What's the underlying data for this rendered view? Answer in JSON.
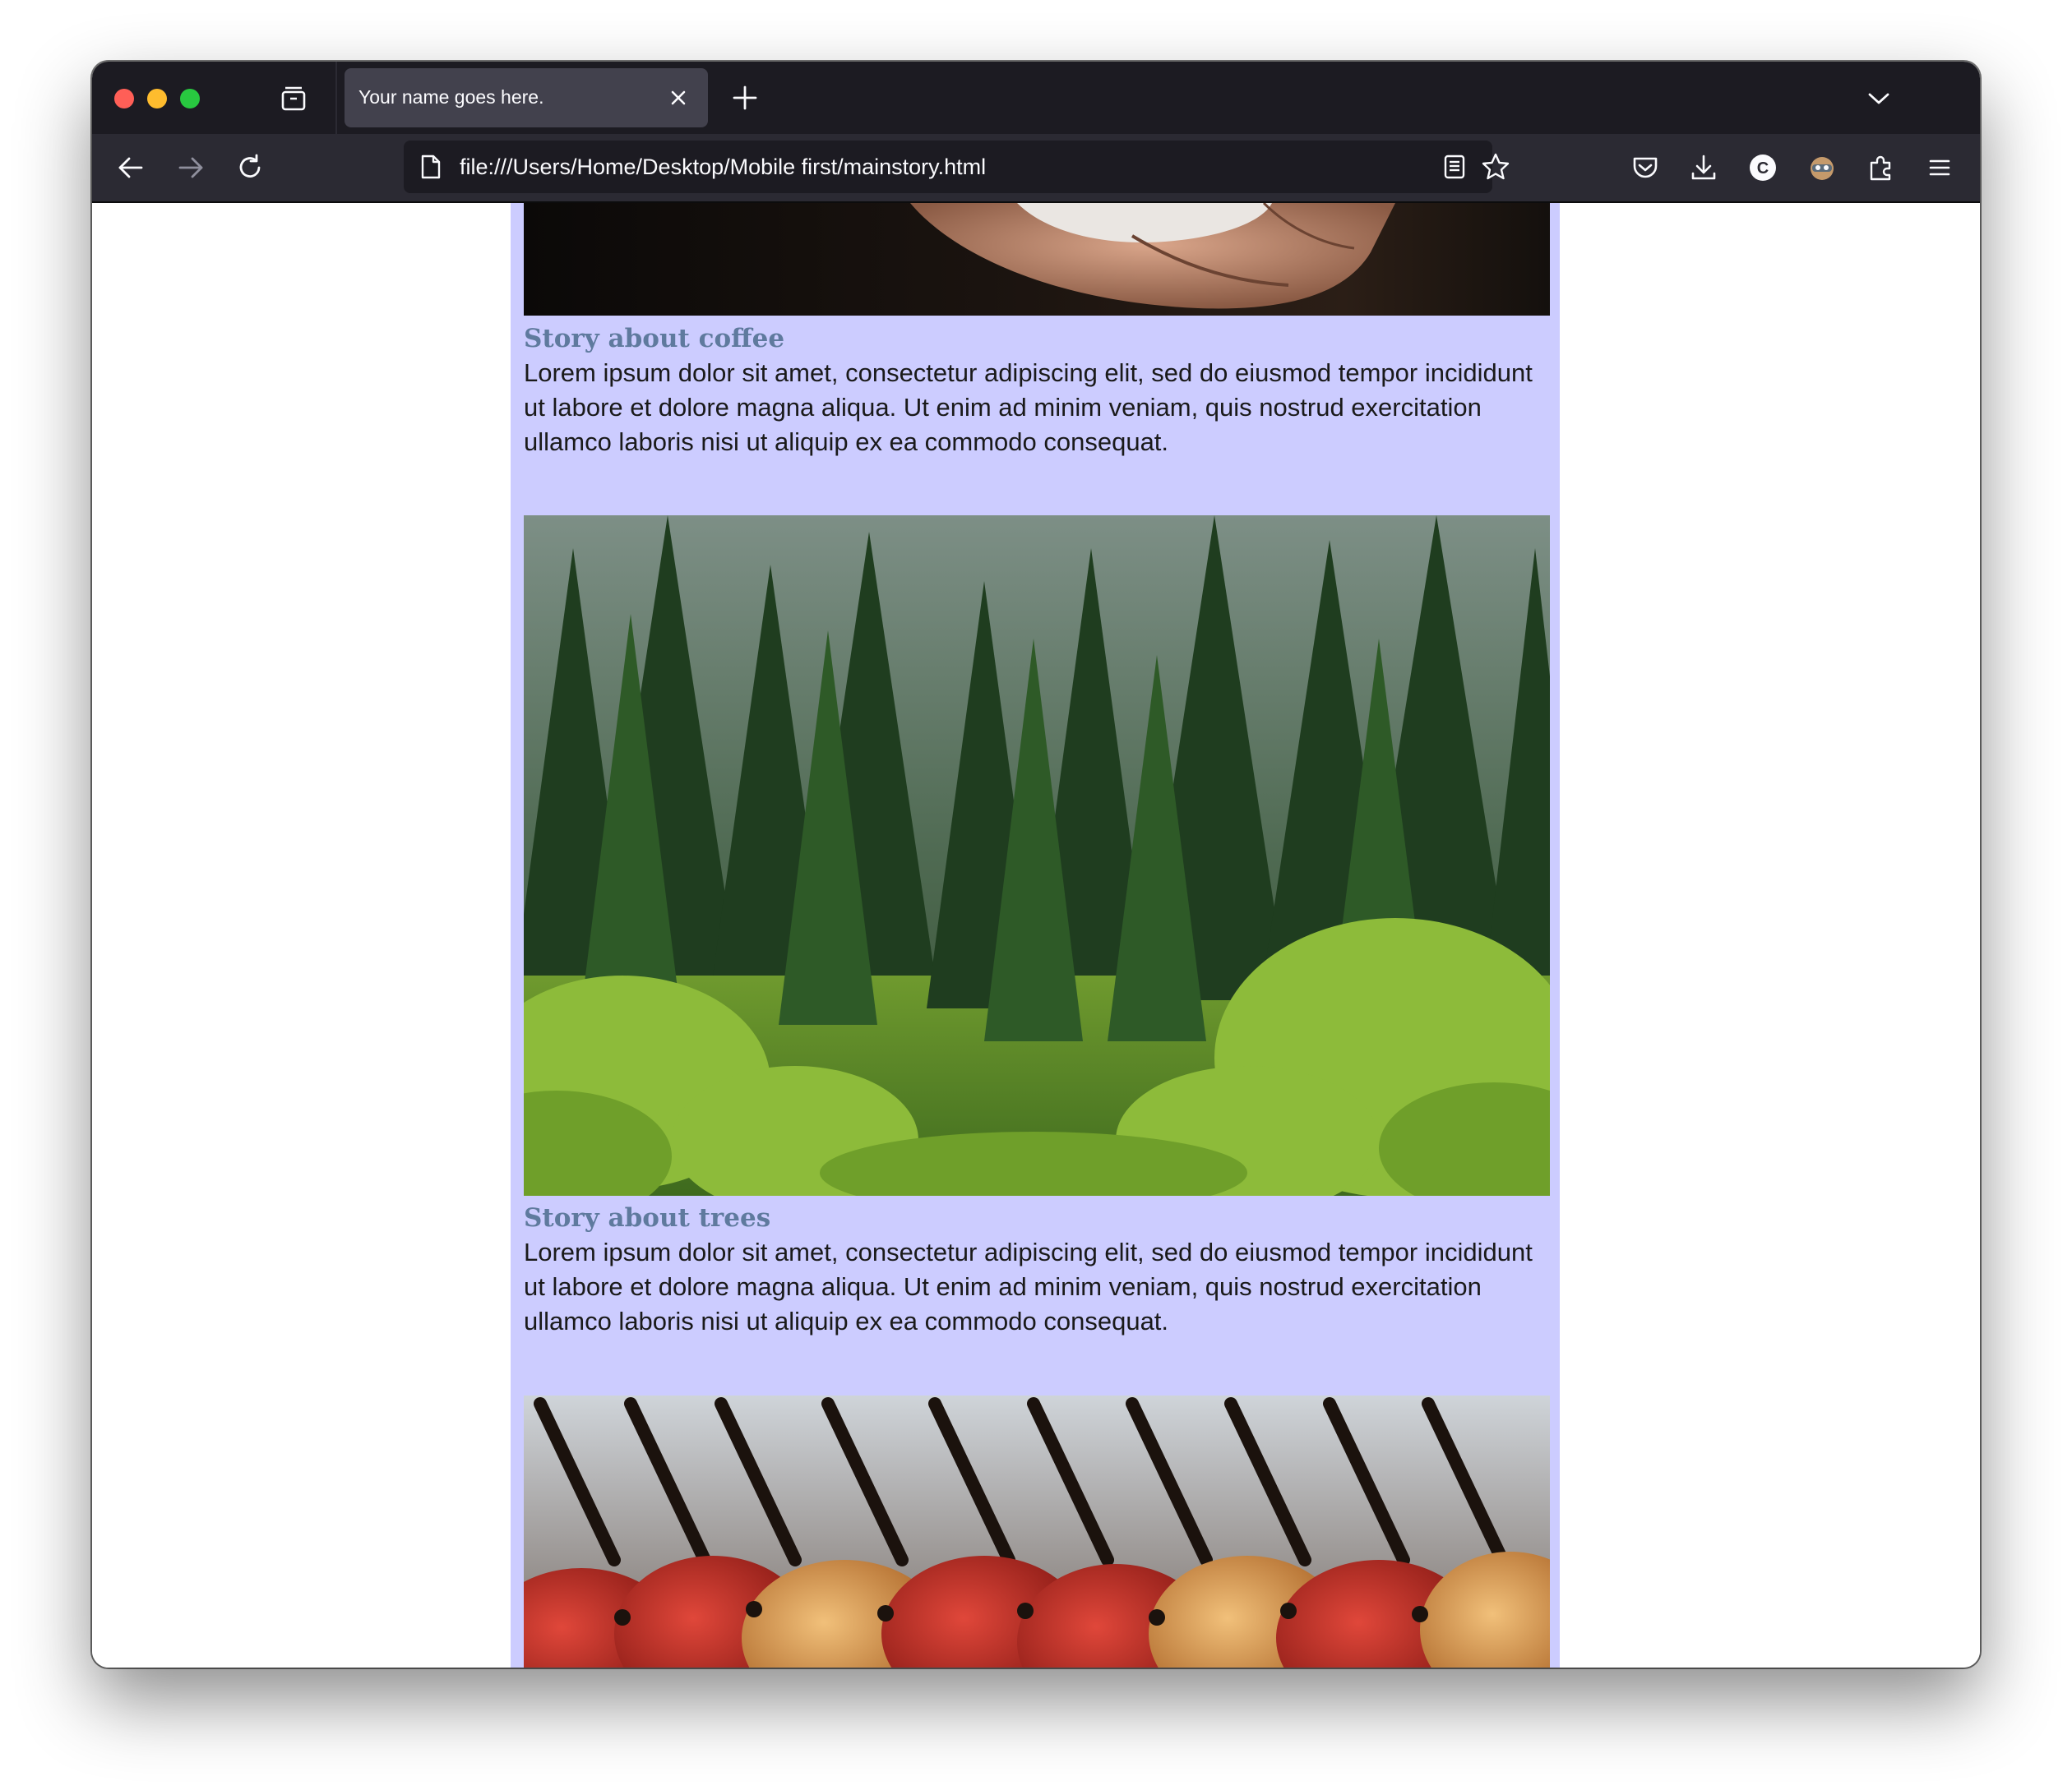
{
  "browser": {
    "tab_title": "Your name goes here.",
    "url": "file:///Users/Home/Desktop/Mobile first/mainstory.html"
  },
  "page": {
    "stories": [
      {
        "title": "Story about coffee",
        "text": "Lorem ipsum dolor sit amet, consectetur adipiscing elit, sed do eiusmod tempor incididunt ut labore et dolore magna aliqua. Ut enim ad minim veniam, quis nostrud exercitation ullamco laboris nisi ut aliquip ex ea commodo consequat."
      },
      {
        "title": "Story about trees",
        "text": "Lorem ipsum dolor sit amet, consectetur adipiscing elit, sed do eiusmod tempor incididunt ut labore et dolore magna aliqua. Ut enim ad minim veniam, quis nostrud exercitation ullamco laboris nisi ut aliquip ex ea commodo consequat."
      }
    ]
  },
  "colors": {
    "column_background": "#ccccff",
    "story_title": "#5f7a9e",
    "tabbar": "#1c1b22",
    "toolbar": "#2b2a33"
  }
}
